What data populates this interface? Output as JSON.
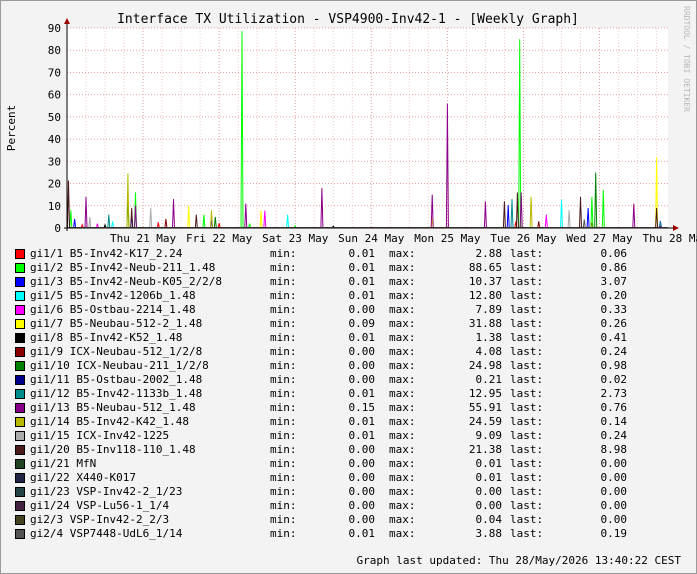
{
  "watermark": "RRDTOOL / TOBI OETIKER",
  "updated": "Graph last updated: Thu 28/May/2026 13:40:22 CEST",
  "labels": {
    "min": "min:",
    "max": "max:",
    "last": "last:"
  },
  "chart_data": {
    "type": "line",
    "title": "Interface TX Utilization - VSP4900-Inv42-1 - [Weekly Graph]",
    "ylabel": "Percent",
    "xlabel": "",
    "ylim": [
      0,
      90
    ],
    "yticks": [
      0,
      10,
      20,
      30,
      40,
      50,
      60,
      70,
      80,
      90
    ],
    "xlim": [
      0,
      7.9
    ],
    "xticks": [
      {
        "x": 1,
        "label": "Thu 21 May"
      },
      {
        "x": 2,
        "label": "Fri 22 May"
      },
      {
        "x": 3,
        "label": "Sat 23 May"
      },
      {
        "x": 4,
        "label": "Sun 24 May"
      },
      {
        "x": 5,
        "label": "Mon 25 May"
      },
      {
        "x": 6,
        "label": "Tue 26 May"
      },
      {
        "x": 7,
        "label": "Wed 27 May"
      },
      {
        "x": 8,
        "label": "Thu 28 May"
      }
    ],
    "grid": true,
    "legend_position": "bottom",
    "series": [
      {
        "name": "gi1/1 B5-Inv42-K17_2.24",
        "color": "#ff0000",
        "min": "0.01",
        "max": "2.88",
        "last": "0.06",
        "points": [
          [
            0.2,
            1.5
          ],
          [
            1.2,
            2.5
          ],
          [
            2.0,
            2.2
          ],
          [
            5.9,
            2.9
          ],
          [
            6.9,
            2.4
          ],
          [
            7.8,
            0.06
          ]
        ]
      },
      {
        "name": "gi1/2 B5-Inv42-Neub-211_1.48",
        "color": "#00ff00",
        "min": "0.01",
        "max": "88.65",
        "last": "0.86",
        "points": [
          [
            0.05,
            8
          ],
          [
            0.9,
            16
          ],
          [
            1.8,
            6
          ],
          [
            2.3,
            88.65
          ],
          [
            2.4,
            2
          ],
          [
            3.0,
            1
          ],
          [
            5.95,
            85
          ],
          [
            6.9,
            14
          ],
          [
            7.05,
            17
          ],
          [
            7.8,
            0.86
          ]
        ]
      },
      {
        "name": "gi1/3 B5-Inv42-Neub-K05_2/2/8",
        "color": "#0000ff",
        "min": "0.01",
        "max": "10.37",
        "last": "3.07",
        "points": [
          [
            0.1,
            4
          ],
          [
            0.85,
            6
          ],
          [
            1.9,
            4
          ],
          [
            5.8,
            10.37
          ],
          [
            6.85,
            9
          ],
          [
            7.8,
            3.07
          ]
        ]
      },
      {
        "name": "gi1/5 B5-Inv42-1206b_1.48",
        "color": "#00ffff",
        "min": "0.01",
        "max": "12.80",
        "last": "0.20",
        "points": [
          [
            0.6,
            3
          ],
          [
            2.9,
            6
          ],
          [
            6.5,
            12.8
          ],
          [
            7.8,
            0.2
          ]
        ]
      },
      {
        "name": "gi1/6 B5-Ostbau-2214_1.48",
        "color": "#ff00ff",
        "min": "0.00",
        "max": "7.89",
        "last": "0.33",
        "points": [
          [
            0.4,
            2
          ],
          [
            2.6,
            7.89
          ],
          [
            6.3,
            6
          ],
          [
            7.8,
            0.33
          ]
        ]
      },
      {
        "name": "gi1/7 B5-Neubau-512-2_1.48",
        "color": "#ffff00",
        "min": "0.09",
        "max": "31.88",
        "last": "0.26",
        "points": [
          [
            1.6,
            10
          ],
          [
            2.55,
            8
          ],
          [
            4.8,
            4
          ],
          [
            7.75,
            31.88
          ],
          [
            7.85,
            0.26
          ]
        ]
      },
      {
        "name": "gi1/8 B5-Inv42-K52_1.48",
        "color": "#000000",
        "min": "0.01",
        "max": "1.38",
        "last": "0.41",
        "points": [
          [
            0.5,
            1.38
          ],
          [
            3.5,
            0.8
          ],
          [
            7.8,
            0.41
          ]
        ]
      },
      {
        "name": "gi1/9 ICX-Neubau-512_1/2/8",
        "color": "#8b0000",
        "min": "0.00",
        "max": "4.08",
        "last": "0.24",
        "points": [
          [
            1.3,
            4.08
          ],
          [
            6.2,
            3
          ],
          [
            7.8,
            0.24
          ]
        ]
      },
      {
        "name": "gi1/10 ICX-Neubau-211_1/2/8",
        "color": "#008000",
        "min": "0.00",
        "max": "24.98",
        "last": "0.98",
        "points": [
          [
            0.8,
            14
          ],
          [
            1.95,
            5
          ],
          [
            6.95,
            24.98
          ],
          [
            7.8,
            0.98
          ]
        ]
      },
      {
        "name": "gi1/11 B5-Ostbau-2002_1.48",
        "color": "#00008b",
        "min": "0.00",
        "max": "0.21",
        "last": "0.02",
        "points": [
          [
            2.0,
            0.21
          ],
          [
            7.8,
            0.02
          ]
        ]
      },
      {
        "name": "gi1/12 B5-Inv42-1133b_1.48",
        "color": "#008b8b",
        "min": "0.01",
        "max": "12.95",
        "last": "2.73",
        "points": [
          [
            0.55,
            6
          ],
          [
            5.85,
            12.95
          ],
          [
            7.8,
            2.73
          ]
        ]
      },
      {
        "name": "gi1/13 B5-Neubau-512_1.48",
        "color": "#8b008b",
        "min": "0.15",
        "max": "55.91",
        "last": "0.76",
        "points": [
          [
            0.25,
            14
          ],
          [
            0.9,
            10
          ],
          [
            1.4,
            13
          ],
          [
            2.35,
            11
          ],
          [
            3.35,
            18
          ],
          [
            4.8,
            15
          ],
          [
            5.0,
            55.91
          ],
          [
            5.5,
            12
          ],
          [
            5.97,
            16
          ],
          [
            7.45,
            11
          ],
          [
            7.8,
            0.76
          ]
        ]
      },
      {
        "name": "gi1/14 B5-Inv42-K42_1.48",
        "color": "#b8b800",
        "min": "0.01",
        "max": "24.59",
        "last": "0.14",
        "points": [
          [
            0.8,
            24.59
          ],
          [
            1.9,
            8
          ],
          [
            6.1,
            14
          ],
          [
            7.8,
            0.14
          ]
        ]
      },
      {
        "name": "gi1/15 ICX-Inv42-1225",
        "color": "#aaaaaa",
        "min": "0.01",
        "max": "9.09",
        "last": "0.24",
        "points": [
          [
            0.3,
            5
          ],
          [
            1.1,
            9.09
          ],
          [
            6.6,
            8
          ],
          [
            7.8,
            0.24
          ]
        ]
      },
      {
        "name": "gi1/20 B5-Inv118-110_1.48",
        "color": "#4b1a1a",
        "min": "0.00",
        "max": "21.38",
        "last": "8.98",
        "points": [
          [
            0.02,
            21.38
          ],
          [
            0.85,
            9
          ],
          [
            1.7,
            6
          ],
          [
            5.75,
            12
          ],
          [
            5.92,
            16
          ],
          [
            6.75,
            14
          ],
          [
            7.75,
            8.98
          ]
        ]
      },
      {
        "name": "gi1/21 MfN",
        "color": "#224422",
        "min": "0.00",
        "max": "0.01",
        "last": "0.00",
        "points": []
      },
      {
        "name": "gi1/22 X440-K017",
        "color": "#222244",
        "min": "0.00",
        "max": "0.01",
        "last": "0.00",
        "points": []
      },
      {
        "name": "gi1/23 VSP-Inv42-2_1/23",
        "color": "#224444",
        "min": "0.00",
        "max": "0.00",
        "last": "0.00",
        "points": []
      },
      {
        "name": "gi1/24 VSP-Lu56-1_1/4",
        "color": "#442244",
        "min": "0.00",
        "max": "0.00",
        "last": "0.00",
        "points": []
      },
      {
        "name": "gi2/3 VSP-Inv42-2_2/3",
        "color": "#444422",
        "min": "0.00",
        "max": "0.04",
        "last": "0.00",
        "points": []
      },
      {
        "name": "gi2/4 VSP7448-UdL6_1/14",
        "color": "#555555",
        "min": "0.01",
        "max": "3.88",
        "last": "0.19",
        "points": [
          [
            6.8,
            3.88
          ],
          [
            7.8,
            0.19
          ]
        ]
      }
    ]
  }
}
